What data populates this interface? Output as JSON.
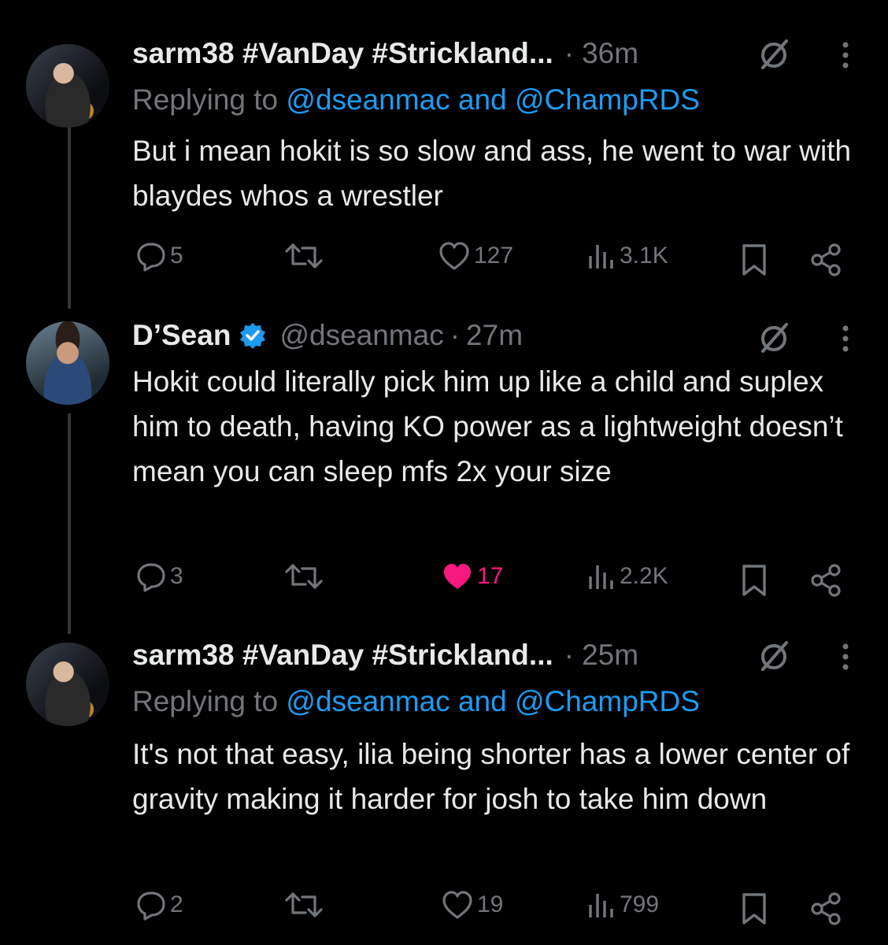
{
  "tweets": [
    {
      "author": "sarm38 #VanDay #Strickland...",
      "separator": "·",
      "time": "36m",
      "replying_prefix": "Replying to",
      "replying_users": "@dseanmac and @ChampRDS",
      "text": "But i mean hokit is so slow and ass, he went to war with blaydes whos a wrestler",
      "replies": "5",
      "likes": "127",
      "views": "3.1K"
    },
    {
      "author": "D’Sean",
      "handle": "@dseanmac",
      "separator": "·",
      "time": "27m",
      "text": "Hokit could literally pick him up like a child and suplex him to death, having KO power as a lightweight doesn’t mean you can sleep mfs 2x your size",
      "replies": "3",
      "likes": "17",
      "views": "2.2K",
      "liked": true
    },
    {
      "author": "sarm38 #VanDay #Strickland...",
      "separator": "·",
      "time": "25m",
      "replying_prefix": "Replying to",
      "replying_users": "@dseanmac and @ChampRDS",
      "text": "It's not that easy, ilia being shorter has a lower center of gravity making it harder for josh to take him down",
      "replies": "2",
      "likes": "19",
      "views": "799"
    }
  ],
  "colors": {
    "background": "#000000",
    "text": "#e7e9ea",
    "muted": "#71767b",
    "link": "#1d9bf0",
    "like_active": "#f91880",
    "verified": "#1d9bf0"
  },
  "icons": [
    "reply-icon",
    "retweet-icon",
    "like-icon",
    "views-icon",
    "bookmark-icon",
    "share-icon",
    "grok-slash-icon",
    "more-icon",
    "verified-badge-icon"
  ]
}
